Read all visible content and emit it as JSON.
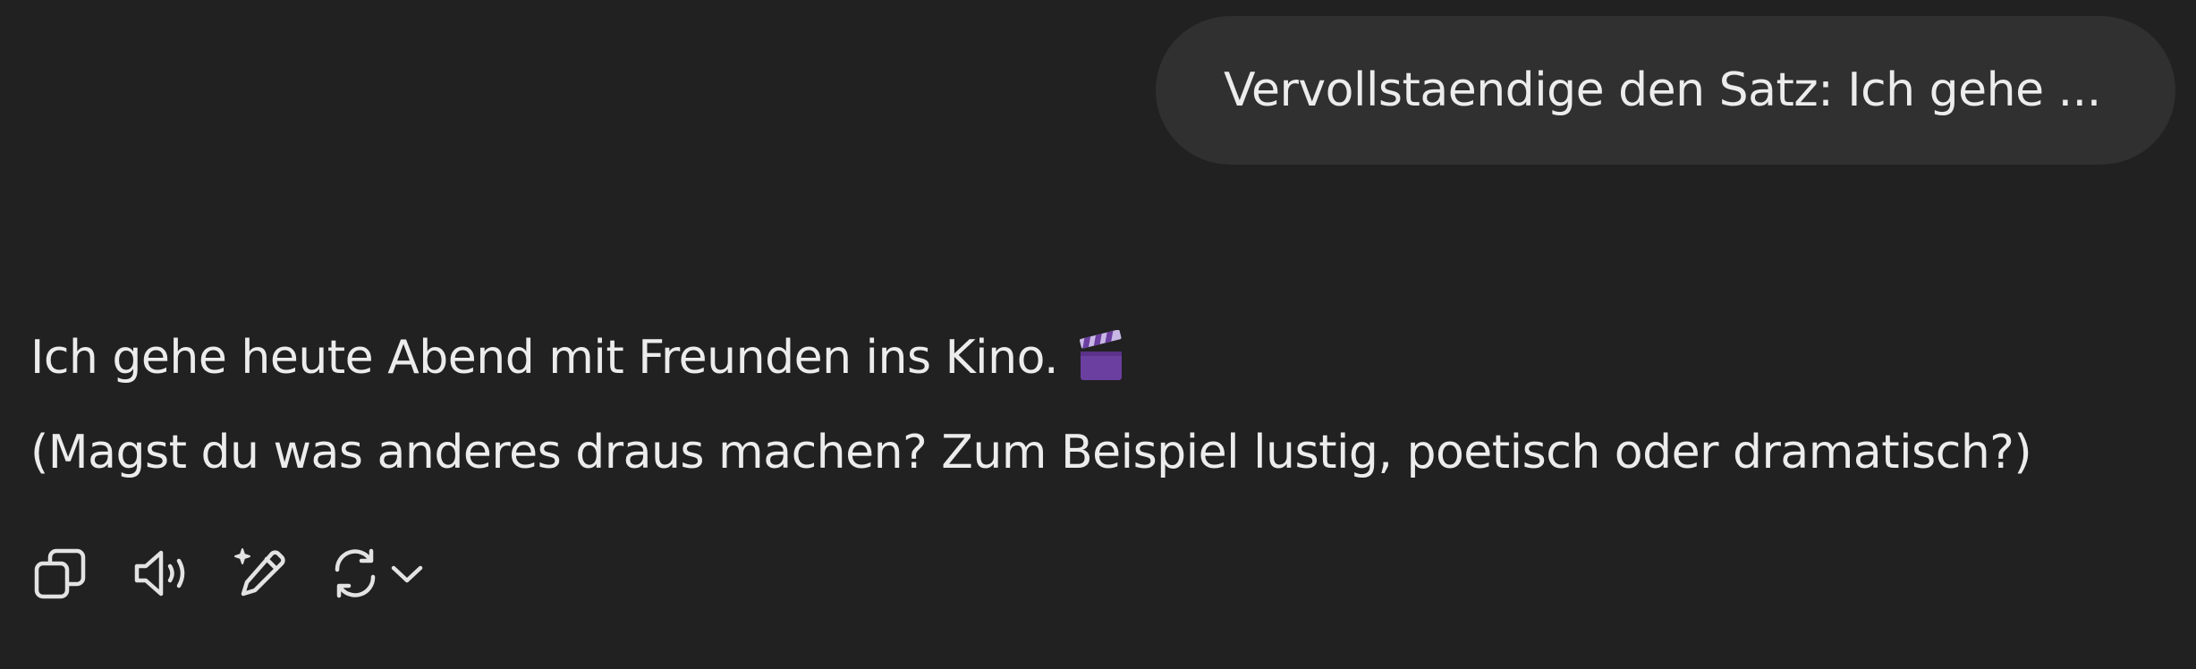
{
  "conversation": {
    "user_message": "Vervollstaendige den Satz: Ich gehe ...",
    "assistant_line_1": "Ich gehe heute Abend mit Freunden ins Kino.",
    "assistant_emoji": "clapper-board",
    "assistant_line_2": "(Magst du was anderes draus machen? Zum Beispiel lustig, poetisch oder dramatisch?)"
  },
  "toolbar": {
    "icons": [
      "copy-icon",
      "read-aloud-icon",
      "edit-sparkle-icon",
      "regenerate-icon",
      "chevron-down-icon"
    ]
  },
  "colors": {
    "background": "#212121",
    "user_bubble": "#303030",
    "text": "#ececec",
    "emoji_purple": "#6b3fa0"
  }
}
